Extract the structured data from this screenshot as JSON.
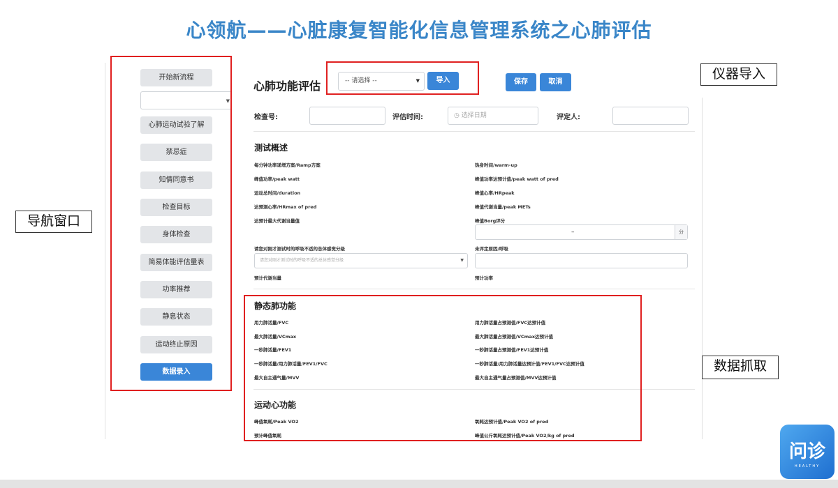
{
  "title": "心领航——心脏康复智能化信息管理系统之心肺评估",
  "callouts": {
    "nav": "导航窗口",
    "import": "仪器导入",
    "grab": "数据抓取"
  },
  "nav": {
    "buttons": [
      "开始新流程",
      "心肺运动试验了解",
      "禁忌症",
      "知情同意书",
      "检查目标",
      "身体检查",
      "简易体能评估量表",
      "功率推荐",
      "静息状态",
      "运动终止原因"
    ],
    "primary": "数据录入"
  },
  "header": {
    "title": "心肺功能评估",
    "select_placeholder": "-- 请选择 --",
    "import_label": "导入",
    "save_label": "保存",
    "cancel_label": "取消"
  },
  "form": {
    "exam_no_label": "检查号:",
    "eval_time_label": "评估时间:",
    "date_placeholder": "选择日期",
    "evaluator_label": "评定人:"
  },
  "overview": {
    "title": "测试概述",
    "left": [
      "每分钟功率递增方案/Ramp方案",
      "峰值功率/peak watt",
      "运动总时间/duration",
      "达预测心率/HRmax of pred",
      "达预计最大代谢当量值"
    ],
    "right": [
      "热身时间/warm-up",
      "峰值功率达预计值/peak watt of pred",
      "峰值心率/HRpeak",
      "峰值代谢当量/peak METs",
      "峰值Borg评分"
    ],
    "borg_unit": "分",
    "borg_value": "–",
    "breath_label": "请您对刚才测试时的呼吸不适的总体感觉分级",
    "breath_placeholder": "请您对刚才测试时的呼吸不适的总体感觉分级",
    "unfinished_label": "未评定原因/呼吸",
    "predicted_met_label": "预计代谢当量",
    "predicted_power_label": "预计功率"
  },
  "static_lung": {
    "title": "静态肺功能",
    "left": [
      "用力肺活量/FVC",
      "最大肺活量/VCmax",
      "一秒肺活量/FEV1",
      "一秒肺活量/用力肺活量/FEV1/FVC",
      "最大自主通气量/MVV"
    ],
    "right": [
      "用力肺活量占预测值/FVC达预计值",
      "最大肺活量占预测值/VCmax达预计值",
      "一秒肺活量占预测值/FEV1达预计值",
      "一秒肺活量/用力肺活量达预计值/FEV1/FVC达预计值",
      "最大自主通气量占预测值/MVV达预计值"
    ]
  },
  "exercise": {
    "title": "运动心功能",
    "left": [
      "峰值氧耗/Peak VO2",
      "预计峰值氧耗"
    ],
    "right": [
      "氧耗达预计值/Peak VO2 of pred",
      "峰值公斤氧耗达预计值/Peak VO2/kg of pred"
    ]
  },
  "logo": {
    "main": "问诊",
    "sub": "HEALTHY"
  }
}
